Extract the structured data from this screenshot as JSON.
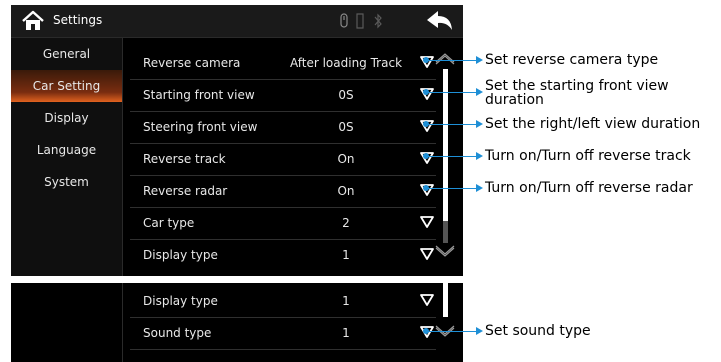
{
  "header": {
    "title": "Settings",
    "icons": [
      "home-icon",
      "usb-icon",
      "sd-card-icon",
      "bluetooth-icon",
      "back-icon"
    ]
  },
  "sidebar": {
    "items": [
      {
        "label": "General",
        "active": false
      },
      {
        "label": "Car Setting",
        "active": true
      },
      {
        "label": "Display",
        "active": false
      },
      {
        "label": "Language",
        "active": false
      },
      {
        "label": "System",
        "active": false
      }
    ]
  },
  "settings": {
    "rows": [
      {
        "label": "Reverse camera",
        "value": "After loading Track"
      },
      {
        "label": "Starting front view",
        "value": "0S"
      },
      {
        "label": "Steering front view",
        "value": "0S"
      },
      {
        "label": "Reverse track",
        "value": "On"
      },
      {
        "label": "Reverse radar",
        "value": "On"
      },
      {
        "label": "Car type",
        "value": "2"
      },
      {
        "label": "Display type",
        "value": "1"
      }
    ]
  },
  "settings_scrolled": {
    "rows": [
      {
        "label": "Display type",
        "value": "1"
      },
      {
        "label": "Sound type",
        "value": "1"
      }
    ]
  },
  "annotations": [
    "Set reverse camera type",
    "Set the starting front view",
    "duration",
    "Set the right/left view duration",
    "Turn on/Turn off reverse track",
    "Turn on/Turn off reverse radar",
    "Set sound type"
  ],
  "colors": {
    "accent": "#e1621f",
    "annotation": "#1e8fd6",
    "background": "#000000",
    "text": "#e8e8e8"
  }
}
